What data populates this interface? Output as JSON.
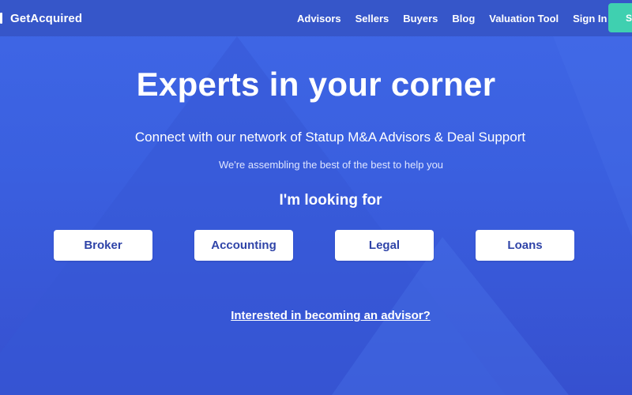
{
  "header": {
    "logo_text": "GetAcquired",
    "nav": [
      "Advisors",
      "Sellers",
      "Buyers",
      "Blog",
      "Valuation Tool",
      "Sign In"
    ],
    "cta_label": "S"
  },
  "hero": {
    "title": "Experts in your corner",
    "subtitle": "Connect with our network of Statup M&A Advisors & Deal Support",
    "subtext": "We're assembling the best of the best to help you",
    "looking_label": "I'm looking for",
    "categories": [
      "Broker",
      "Accounting",
      "Legal",
      "Loans"
    ],
    "advisor_link": "Interested in becoming an advisor?"
  },
  "colors": {
    "background": "#3a5ee0",
    "header": "#3656c9",
    "cta": "#3fd0b0",
    "button_text": "#2f44a8"
  }
}
